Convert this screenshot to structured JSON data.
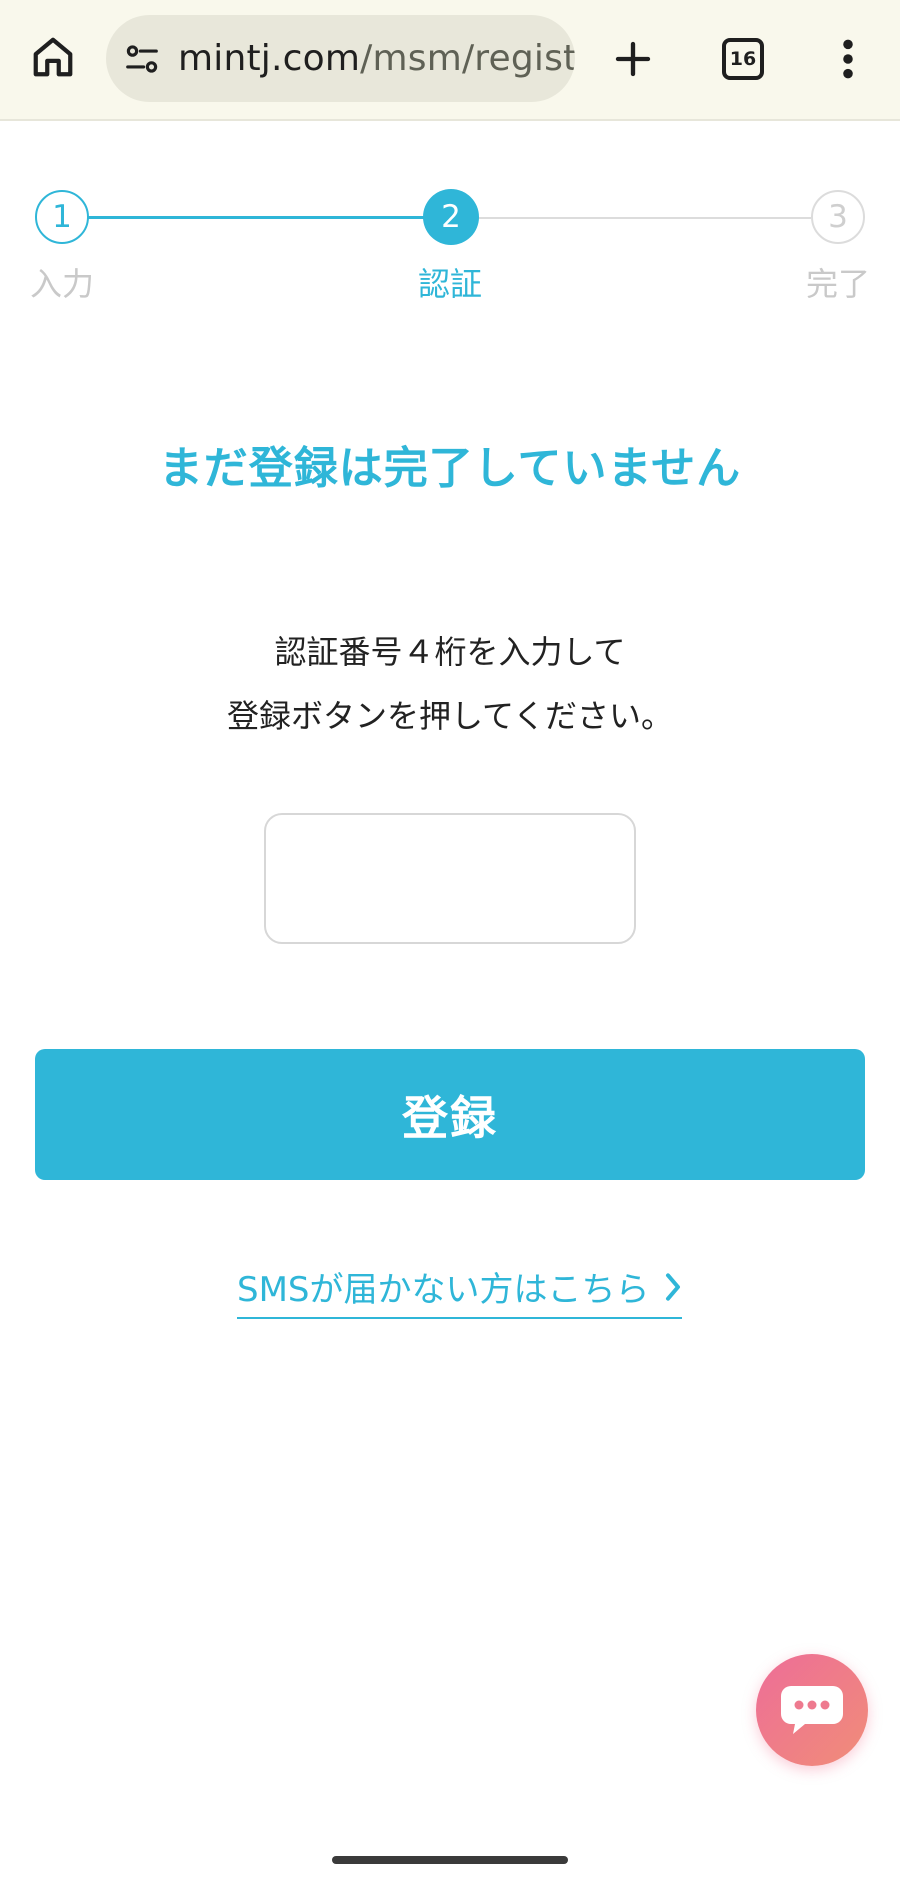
{
  "browser": {
    "url_host": "mintj.com",
    "url_path": "/msm/registrat",
    "tab_count": "16"
  },
  "stepper": {
    "steps": [
      {
        "number": "1",
        "label": "入力"
      },
      {
        "number": "2",
        "label": "認証"
      },
      {
        "number": "3",
        "label": "完了"
      }
    ],
    "current_step": 2
  },
  "main": {
    "title": "まだ登録は完了していません",
    "instruction_line1": "認証番号４桁を入力して",
    "instruction_line2": "登録ボタンを押してください。",
    "code_input_value": "",
    "register_label": "登録",
    "sms_link_label": "SMSが届かない方はこちら"
  },
  "colors": {
    "accent": "#2fb6d8",
    "inactive": "#c9c9c9",
    "chat_gradient_start": "#ee6d98",
    "chat_gradient_end": "#f08d78"
  }
}
